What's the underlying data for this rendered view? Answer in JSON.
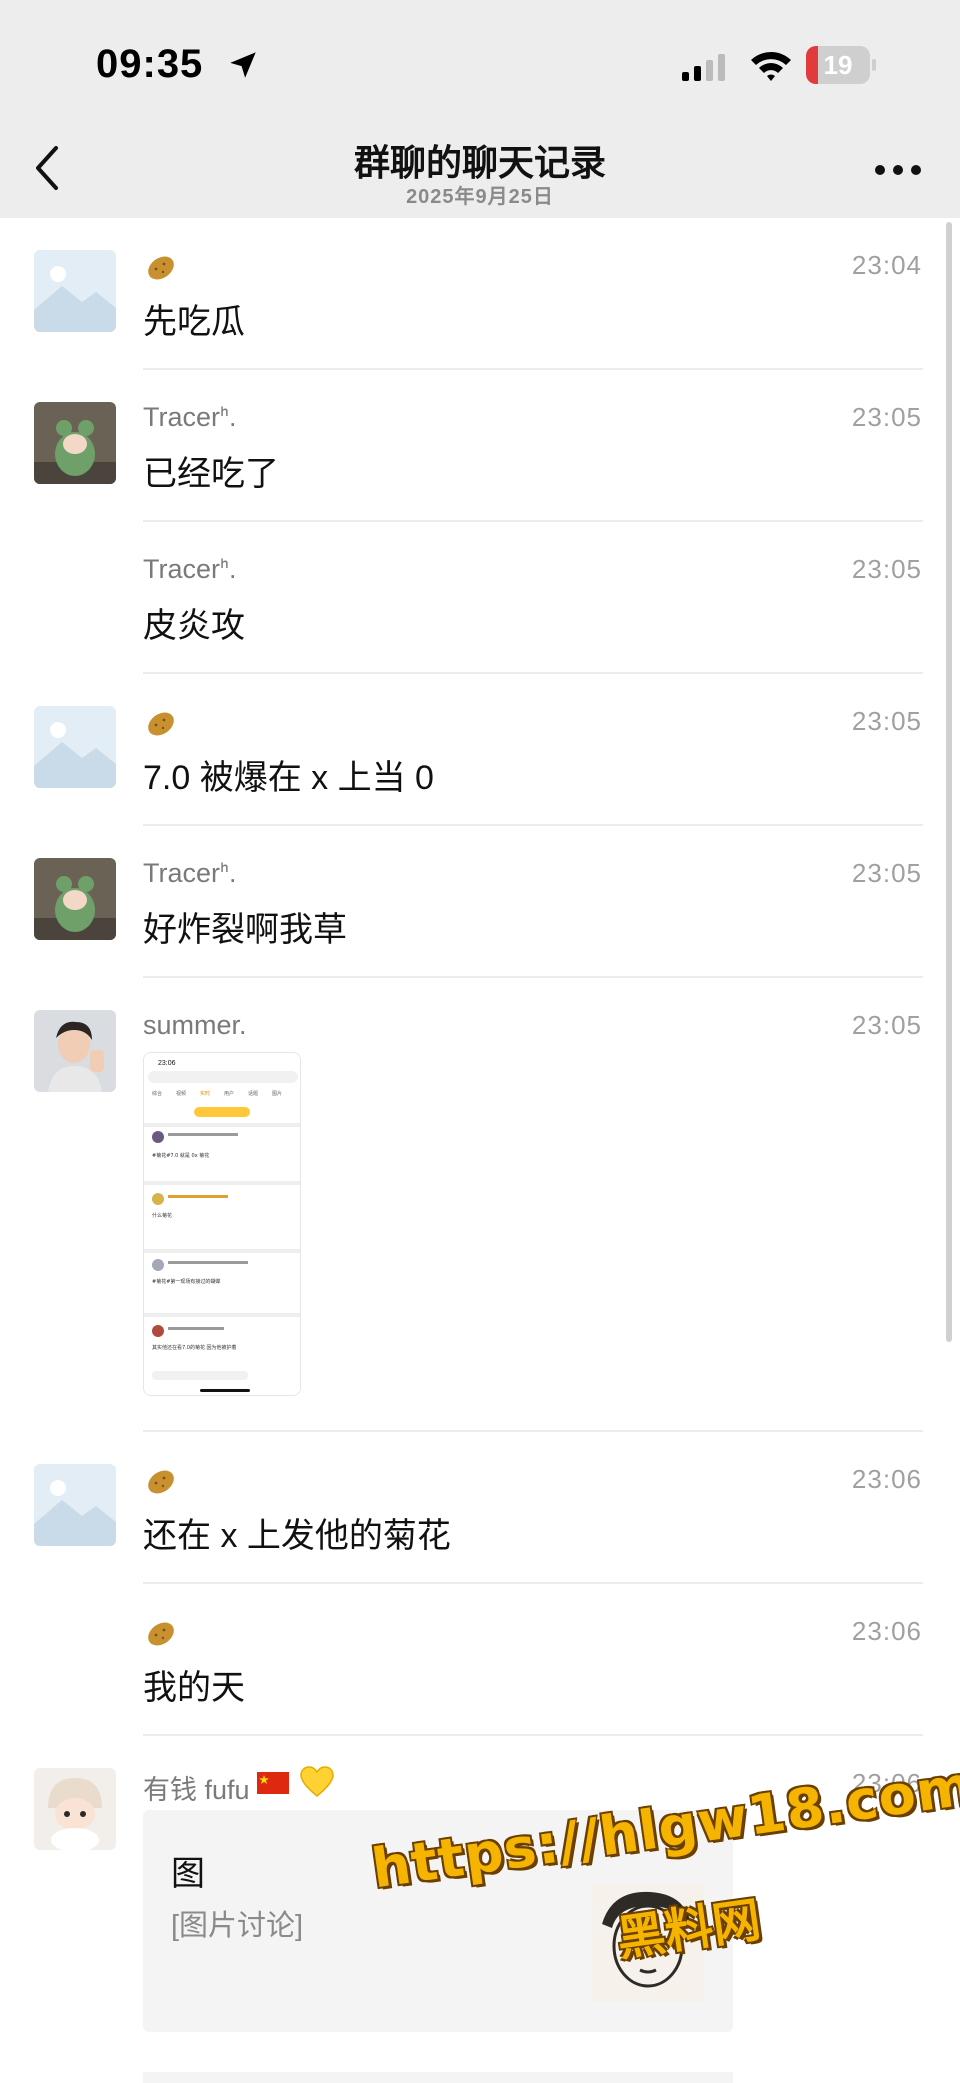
{
  "status": {
    "time": "09:35",
    "battery": 19
  },
  "nav": {
    "title": "群聊的聊天记录",
    "date": "2025年9月25日"
  },
  "messages": [
    {
      "name": "",
      "time": "23:04",
      "text": "先吃瓜"
    },
    {
      "name": "Tracerᑋ.",
      "time": "23:05",
      "text": "已经吃了"
    },
    {
      "name": "Tracerᑋ.",
      "time": "23:05",
      "text": "皮炎攻"
    },
    {
      "name": "",
      "time": "23:05",
      "text": "7.0 被爆在 x 上当 0"
    },
    {
      "name": "Tracerᑋ.",
      "time": "23:05",
      "text": "好炸裂啊我草"
    },
    {
      "name": "summer.",
      "time": "23:05",
      "text": ""
    },
    {
      "name": "",
      "time": "23:06",
      "text": "还在 x 上发他的菊花"
    },
    {
      "name": "",
      "time": "23:06",
      "text": "我的天"
    },
    {
      "name": "有钱 fufu",
      "time": "23:06",
      "text": ""
    }
  ],
  "screenshot": {
    "time": "23:06",
    "tabs": [
      "综合",
      "视频",
      "实时",
      "用户",
      "话题",
      "图片"
    ],
    "posts": [
      "#菊花#7.0 就是 0x 菊花",
      "什么菊花",
      "#菊花#第一现场有接过的蝴蝶",
      "其实他还在看7.0的菊花 因为他被护着"
    ]
  },
  "card": {
    "title": "图",
    "subtitle": "[图片讨论]"
  },
  "watermark": {
    "url": "https://hlgw18.com",
    "name": "黑料网"
  },
  "colors": {
    "header_bg": "#ededed",
    "name_gray": "#7a7a7a",
    "battery_red": "#e23b3b",
    "watermark": "#f5b400"
  }
}
